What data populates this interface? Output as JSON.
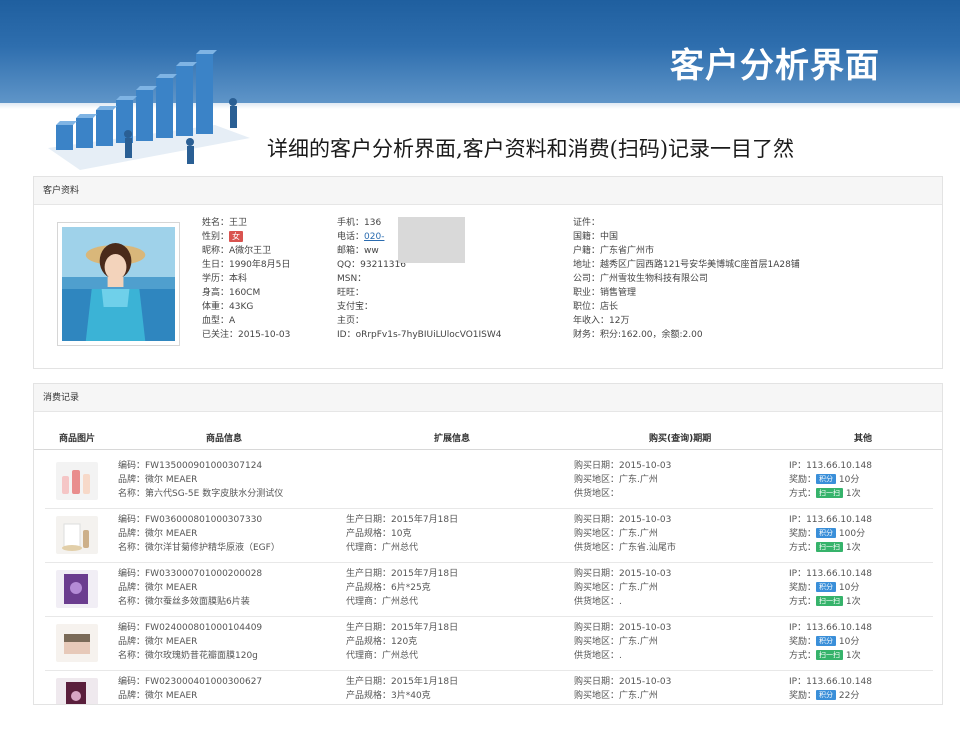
{
  "slide": {
    "title": "客户分析界面",
    "subtitle": "详细的客户分析界面,客户资料和消费(扫码)记录一目了然"
  },
  "profile": {
    "header": "客户资料",
    "col1": {
      "name": "姓名：王卫",
      "gender_label": "性别：",
      "gender_value": "女",
      "nickname": "昵称：A微尔王卫",
      "birthday": "生日：1990年8月5日",
      "education": "学历：本科",
      "height": "身高：160CM",
      "weight": "体重：43KG",
      "blood": "血型：A",
      "followed": "已关注：2015-10-03"
    },
    "col2": {
      "mobile": "手机：136",
      "phone_label": "电话：",
      "phone_value": "020-",
      "email": "邮箱：ww",
      "qq": "QQ：93211316",
      "msn": "MSN：",
      "wangwang": "旺旺：",
      "alipay": "支付宝：",
      "homepage": "主页：",
      "id": "ID：oRrpFv1s-7hyBIUiLUlocVO1ISW4"
    },
    "col3": {
      "idcard": "证件：",
      "nationality": "国籍：中国",
      "hukou": "户籍：广东省广州市",
      "address": "地址：越秀区广园西路121号安华美博城C座首层1A28铺",
      "company": "公司：广州雪妆生物科技有限公司",
      "occupation": "职业：销售管理",
      "position": "职位：店长",
      "income": "年收入：12万",
      "wealth": "财务：积分:162.00，余额:2.00"
    }
  },
  "records": {
    "header": "消费记录",
    "columns": [
      "商品图片",
      "商品信息",
      "扩展信息",
      "购买(查询)期期",
      "其他"
    ],
    "tag_points": "积分",
    "tag_scan": "扫一扫",
    "rows": [
      {
        "thumb": "bottles-thumbnail",
        "code": "编码：FW135000901000307124",
        "brand": "品牌：微尔 MEAER",
        "name": "名称：第六代SG-5E 数字皮肤水分测试仪",
        "prod_date": "",
        "spec": "",
        "agent": "",
        "buy_date": "购买日期：2015-10-03",
        "buy_region": "购买地区：广东.广州",
        "supply": "供货地区：",
        "ip": "IP：113.66.10.148",
        "reward_label": "奖励：",
        "reward_value": "10分",
        "method_label": "方式：",
        "method_value": "1次"
      },
      {
        "thumb": "serum-thumbnail",
        "code": "编码：FW036000801000307330",
        "brand": "品牌：微尔 MEAER",
        "name": "名称：微尔洋甘菊修护精华原液（EGF）",
        "prod_date": "生产日期：2015年7月18日",
        "spec": "产品规格：10克",
        "agent": "代理商：广州总代",
        "buy_date": "购买日期：2015-10-03",
        "buy_region": "购买地区：广东.广州",
        "supply": "供货地区：广东省.汕尾市",
        "ip": "IP：113.66.10.148",
        "reward_label": "奖励：",
        "reward_value": "100分",
        "method_label": "方式：",
        "method_value": "1次"
      },
      {
        "thumb": "mask-box-thumbnail",
        "code": "编码：FW033000701000200028",
        "brand": "品牌：微尔 MEAER",
        "name": "名称：微尔蚕丝多效面膜贴6片装",
        "prod_date": "生产日期：2015年7月18日",
        "spec": "产品规格：6片*25克",
        "agent": "代理商：广州总代",
        "buy_date": "购买日期：2015-10-03",
        "buy_region": "购买地区：广东.广州",
        "supply": "供货地区：.",
        "ip": "IP：113.66.10.148",
        "reward_label": "奖励：",
        "reward_value": "10分",
        "method_label": "方式：",
        "method_value": "1次"
      },
      {
        "thumb": "cream-jar-thumbnail",
        "code": "编码：FW024000801000104409",
        "brand": "品牌：微尔 MEAER",
        "name": "名称：微尔玫瑰奶昔花瓣面膜120g",
        "prod_date": "生产日期：2015年7月18日",
        "spec": "产品规格：120克",
        "agent": "代理商：广州总代",
        "buy_date": "购买日期：2015-10-03",
        "buy_region": "购买地区：广东.广州",
        "supply": "供货地区：.",
        "ip": "IP：113.66.10.148",
        "reward_label": "奖励：",
        "reward_value": "10分",
        "method_label": "方式：",
        "method_value": "1次"
      },
      {
        "thumb": "dark-box-thumbnail",
        "code": "编码：FW023000401000300627",
        "brand": "品牌：微尔 MEAER",
        "name": "",
        "prod_date": "生产日期：2015年1月18日",
        "spec": "产品规格：3片*40克",
        "agent": "",
        "buy_date": "购买日期：2015-10-03",
        "buy_region": "购买地区：广东.广州",
        "supply": "",
        "ip": "IP：113.66.10.148",
        "reward_label": "奖励：",
        "reward_value": "22分",
        "method_label": "",
        "method_value": ""
      }
    ]
  },
  "colors": {
    "banner": "#2e6eae",
    "gender_badge": "#d9534f",
    "points_tag": "#3a8fd9",
    "scan_tag": "#36b36b",
    "link": "#2b6cb0"
  }
}
